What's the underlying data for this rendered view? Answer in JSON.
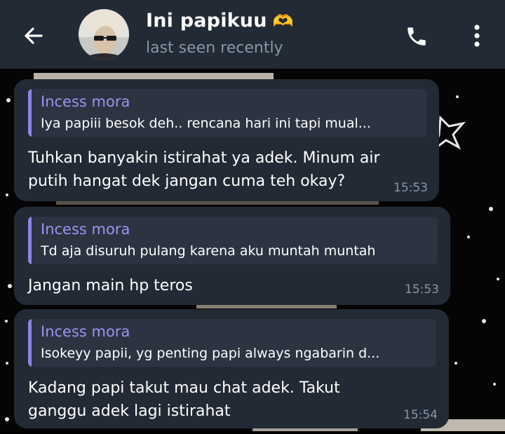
{
  "header": {
    "contact_name": "Ini papikuu",
    "name_emoji": "🫶",
    "status": "last seen recently",
    "back_icon": "arrow-left-icon",
    "call_icon": "phone-icon",
    "menu_icon": "more-vertical-icon"
  },
  "messages": [
    {
      "reply_name": "Incess mora",
      "reply_text": "Iya papiii besok deh.. rencana hari ini tapi mual...",
      "text": "Tuhkan banyakin istirahat ya adek. Minum air\nputih hangat dek jangan cuma teh okay?",
      "time": "15:53"
    },
    {
      "reply_name": "Incess mora",
      "reply_text": "Td aja disuruh pulang karena aku muntah muntah",
      "text": "Jangan main hp teros",
      "time": "15:53"
    },
    {
      "reply_name": "Incess mora",
      "reply_text": "Isokeyy papii, yg penting papi always ngabarin d...",
      "text": "Kadang papi takut mau chat adek. Takut\nganggu adek lagi istirahat",
      "time": "15:54"
    }
  ],
  "colors": {
    "header_bg": "#222a35",
    "bubble_bg": "#222a35",
    "quote_accent": "#8c86e6",
    "reply_name": "#9a94ef",
    "muted": "#8a96a5"
  }
}
